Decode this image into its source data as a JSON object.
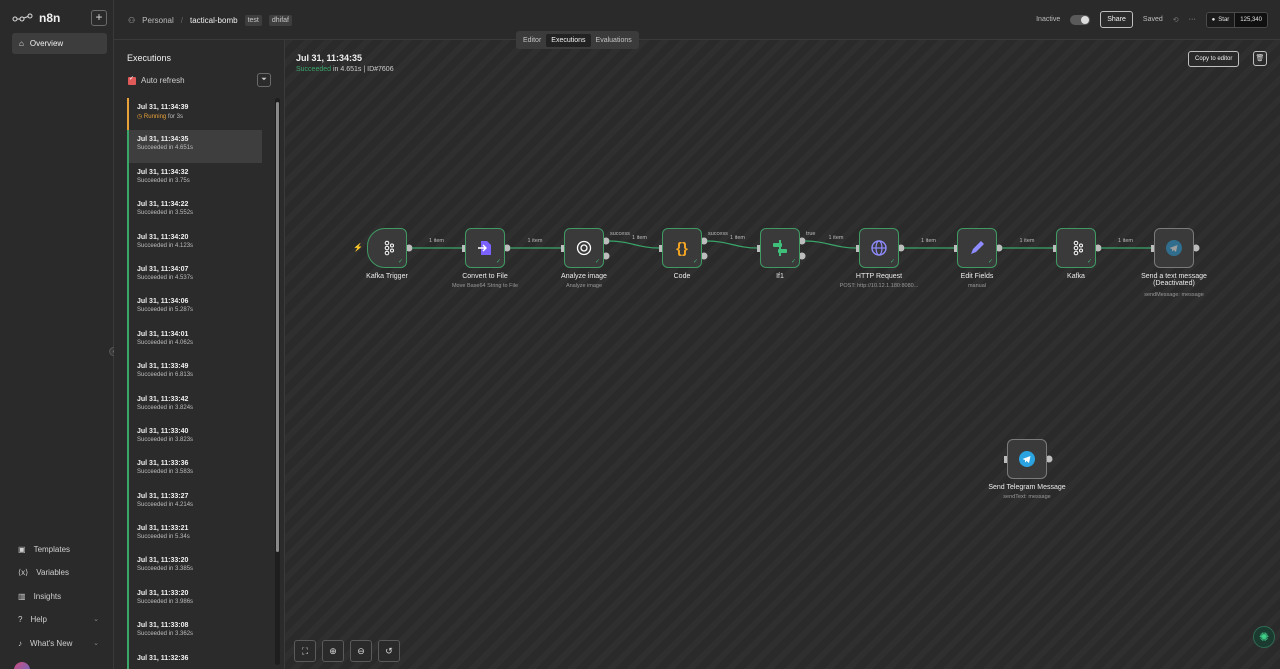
{
  "app": {
    "name": "n8n"
  },
  "sidebar": {
    "add_label": "+",
    "overview": "Overview",
    "bottom_items": [
      {
        "label": "Templates"
      },
      {
        "label": "Variables"
      },
      {
        "label": "Insights"
      },
      {
        "label": "Help"
      },
      {
        "label": "What's New"
      }
    ]
  },
  "header": {
    "project": "Personal",
    "workflow": "tactical-bomb",
    "tags": [
      "test",
      "dhifaf"
    ],
    "tabs": [
      "Editor",
      "Executions",
      "Evaluations"
    ],
    "active_tab": "Executions",
    "status": "Inactive",
    "share": "Share",
    "saved": "Saved",
    "more": "···",
    "github_star": "Star",
    "github_count": "125,340"
  },
  "executions": {
    "title": "Executions",
    "auto_refresh": "Auto refresh",
    "items": [
      {
        "time": "Jul 31, 11:34:39",
        "status": "Running",
        "detail": "for 3s",
        "state": "running"
      },
      {
        "time": "Jul 31, 11:34:35",
        "status": "Succeeded",
        "detail": "in 4.651s",
        "state": "selected"
      },
      {
        "time": "Jul 31, 11:34:32",
        "status": "Succeeded",
        "detail": "in 3.75s",
        "state": "ok"
      },
      {
        "time": "Jul 31, 11:34:22",
        "status": "Succeeded",
        "detail": "in 3.552s",
        "state": "ok"
      },
      {
        "time": "Jul 31, 11:34:20",
        "status": "Succeeded",
        "detail": "in 4.123s",
        "state": "ok"
      },
      {
        "time": "Jul 31, 11:34:07",
        "status": "Succeeded",
        "detail": "in 4.537s",
        "state": "ok"
      },
      {
        "time": "Jul 31, 11:34:06",
        "status": "Succeeded",
        "detail": "in 5.287s",
        "state": "ok"
      },
      {
        "time": "Jul 31, 11:34:01",
        "status": "Succeeded",
        "detail": "in 4.062s",
        "state": "ok"
      },
      {
        "time": "Jul 31, 11:33:49",
        "status": "Succeeded",
        "detail": "in 6.813s",
        "state": "ok"
      },
      {
        "time": "Jul 31, 11:33:42",
        "status": "Succeeded",
        "detail": "in 3.824s",
        "state": "ok"
      },
      {
        "time": "Jul 31, 11:33:40",
        "status": "Succeeded",
        "detail": "in 3.823s",
        "state": "ok"
      },
      {
        "time": "Jul 31, 11:33:36",
        "status": "Succeeded",
        "detail": "in 3.583s",
        "state": "ok"
      },
      {
        "time": "Jul 31, 11:33:27",
        "status": "Succeeded",
        "detail": "in 4.214s",
        "state": "ok"
      },
      {
        "time": "Jul 31, 11:33:21",
        "status": "Succeeded",
        "detail": "in 5.34s",
        "state": "ok"
      },
      {
        "time": "Jul 31, 11:33:20",
        "status": "Succeeded",
        "detail": "in 3.385s",
        "state": "ok"
      },
      {
        "time": "Jul 31, 11:33:20",
        "status": "Succeeded",
        "detail": "in 3.986s",
        "state": "ok"
      },
      {
        "time": "Jul 31, 11:33:08",
        "status": "Succeeded",
        "detail": "in 3.362s",
        "state": "ok"
      },
      {
        "time": "Jul 31, 11:32:36",
        "status": "",
        "detail": "",
        "state": "ok"
      }
    ]
  },
  "canvas": {
    "exec_time": "Jul 31, 11:34:35",
    "exec_status": "Succeeded",
    "exec_duration": "in 4.651s",
    "exec_id": "| ID#7606",
    "copy_to_editor": "Copy to editor",
    "nodes": [
      {
        "id": "kafka-trigger",
        "label": "Kafka Trigger",
        "sub": "",
        "icon": "kafka-icon"
      },
      {
        "id": "convert-to-file",
        "label": "Convert to File",
        "sub": "Move Base64 String to File",
        "icon": "convert-file-icon"
      },
      {
        "id": "analyze-image",
        "label": "Analyze image",
        "sub": "Analyze image",
        "icon": "openai-icon"
      },
      {
        "id": "code",
        "label": "Code",
        "sub": "",
        "icon": "code-icon"
      },
      {
        "id": "if1",
        "label": "If1",
        "sub": "",
        "icon": "if-icon"
      },
      {
        "id": "http-request",
        "label": "HTTP Request",
        "sub": "POST: http://10.12.1.180:8080...",
        "icon": "globe-icon"
      },
      {
        "id": "edit-fields",
        "label": "Edit Fields",
        "sub": "manual",
        "icon": "pencil-icon"
      },
      {
        "id": "kafka",
        "label": "Kafka",
        "sub": "",
        "icon": "kafka-icon"
      },
      {
        "id": "send-text",
        "label": "Send a text message (Deactivated)",
        "sub": "sendMessage: message",
        "icon": "telegram-icon"
      },
      {
        "id": "send-telegram",
        "label": "Send Telegram Message",
        "sub": "sendText: message",
        "icon": "telegram-icon"
      }
    ],
    "wire_labels": [
      "1 item",
      "1 item",
      "success",
      "1 item",
      "success",
      "1 item",
      "true",
      "1 item",
      "1 item",
      "1 item",
      "1 item"
    ],
    "colors": {
      "success": "#3aa66a",
      "running": "#e8a23a",
      "trigger": "#ff6d5a"
    }
  }
}
